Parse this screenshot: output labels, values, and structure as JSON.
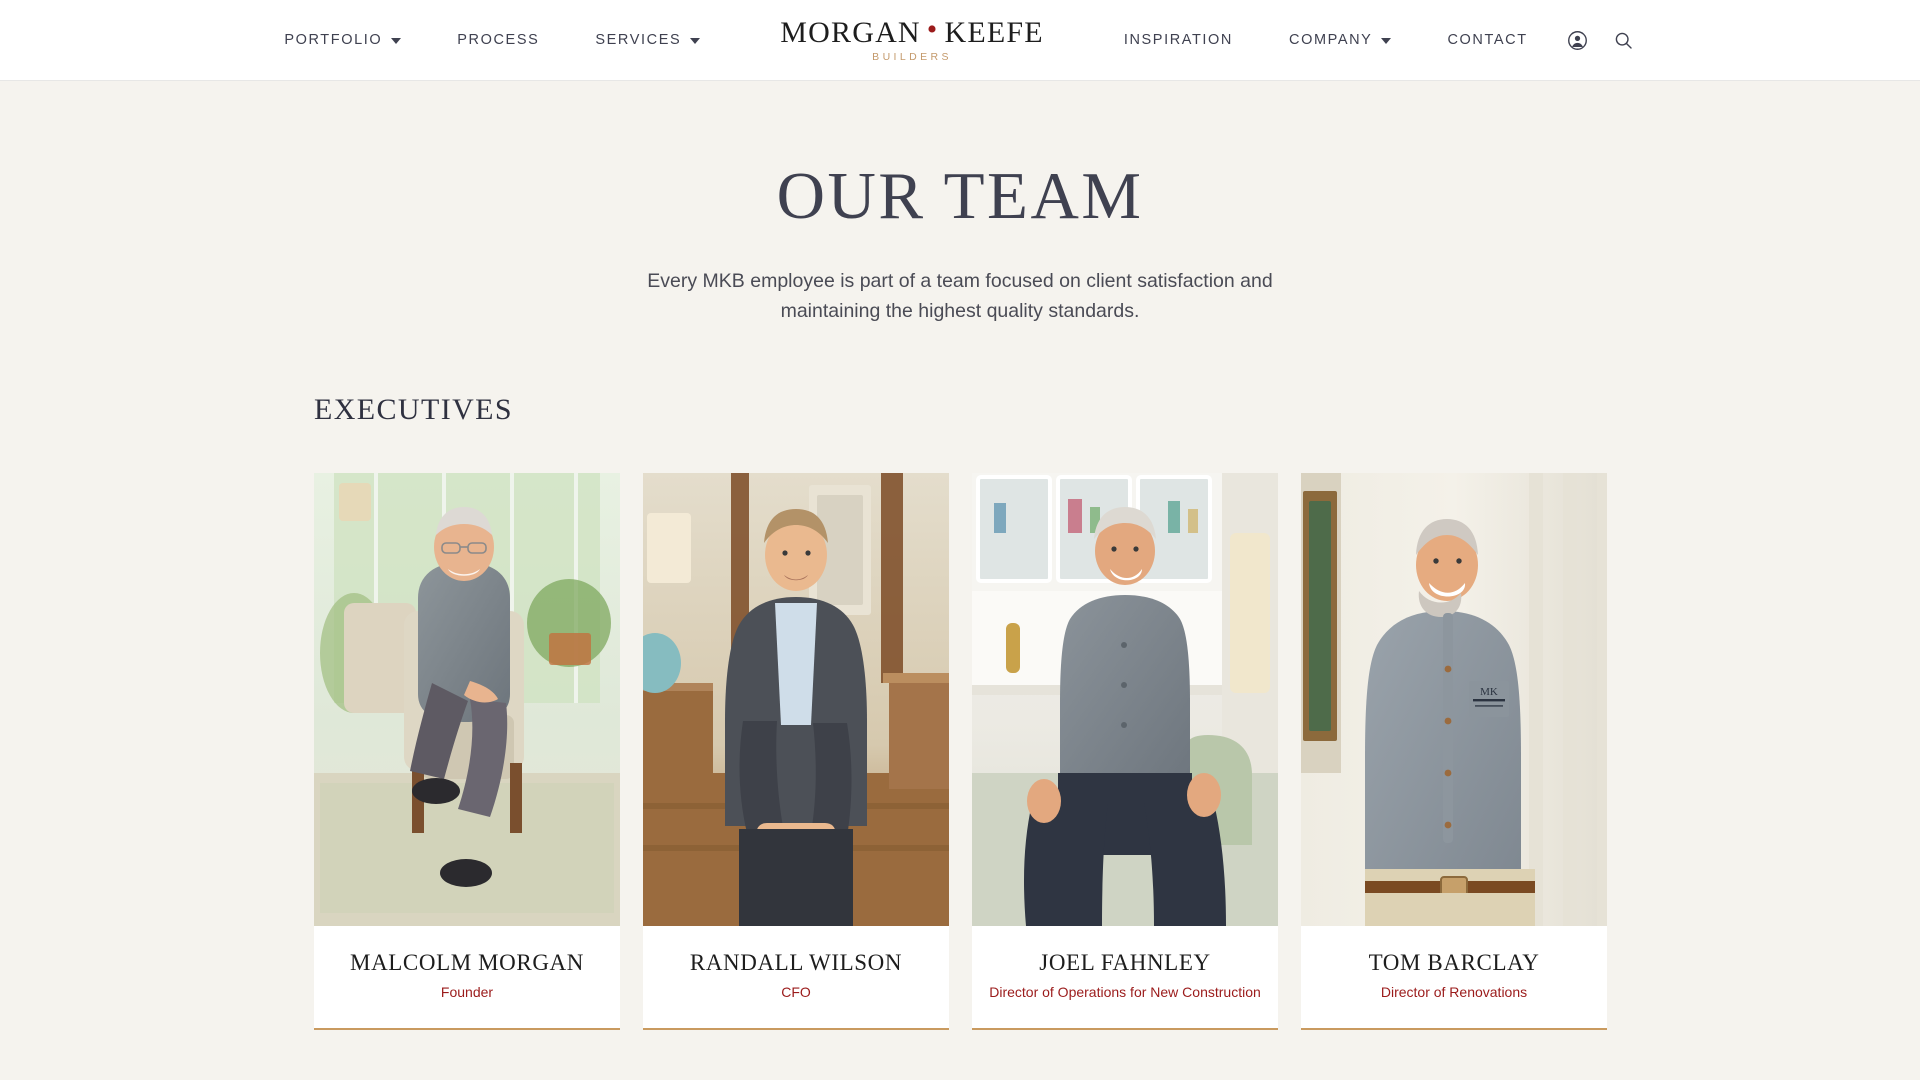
{
  "header": {
    "nav_left": [
      {
        "label": "PORTFOLIO",
        "has_dropdown": true
      },
      {
        "label": "PROCESS",
        "has_dropdown": false
      },
      {
        "label": "SERVICES",
        "has_dropdown": true
      }
    ],
    "nav_right": [
      {
        "label": "INSPIRATION",
        "has_dropdown": false
      },
      {
        "label": "COMPANY",
        "has_dropdown": true
      },
      {
        "label": "CONTACT",
        "has_dropdown": false
      }
    ],
    "logo": {
      "word_one": "MORGAN",
      "separator": "•",
      "word_two": "KEEFE",
      "tagline": "BUILDERS",
      "dot_color": "#9b1b1b",
      "tagline_color": "#c49a6c"
    },
    "icons": {
      "account": "account-icon",
      "search": "search-icon"
    }
  },
  "main": {
    "title": "OUR TEAM",
    "subtitle": "Every MKB employee is part of a team focused on client satisfaction and maintaining the highest quality standards.",
    "section_title": "EXECUTIVES",
    "members": [
      {
        "name": "MALCOLM MORGAN",
        "role": "Founder",
        "photo_alt": "Older smiling man with glasses in a gray button-down shirt and dark trousers, seated in a cream upholstered armchair in front of tall bright windows with green foliage outside",
        "photo_key": "portrait-malcolm-morgan"
      },
      {
        "name": "RANDALL WILSON",
        "role": "CFO",
        "photo_alt": "Man in a charcoal tweed blazer and light blue dress shirt, seated with hands clasped in a warm wood-toned interior with a table lamp behind him",
        "photo_key": "portrait-randall-wilson"
      },
      {
        "name": "JOEL FAHNLEY",
        "role": "Director of Operations for New Construction",
        "photo_alt": "Smiling man with short light hair in a gray button-down shirt and navy trousers, seated on a pale sofa in a bright white kitchen with glass-front cabinets",
        "photo_key": "portrait-joel-fahnley"
      },
      {
        "name": "TOM BARCLAY",
        "role": "Director of Renovations",
        "photo_alt": "Smiling bearded man in a gray Morgan-Keefe Builders logo work shirt and khaki pants standing in a light hallway beside a framed picture",
        "photo_key": "portrait-tom-barclay"
      }
    ],
    "accent_colors": {
      "role_text": "#9b1b1b",
      "card_underline": "#c99a5f",
      "page_background": "#f5f3ee",
      "heading": "#3f4150"
    }
  }
}
